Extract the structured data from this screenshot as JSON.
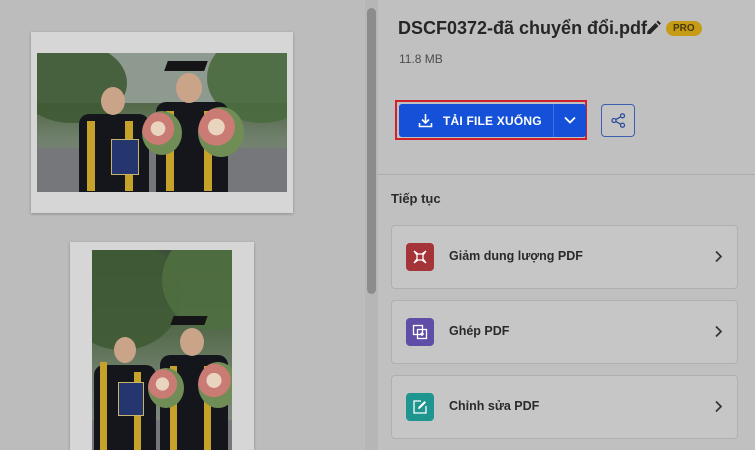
{
  "file": {
    "name": "DSCF0372-đã chuyển đổi.pdf",
    "size": "11.8 MB",
    "badge": "PRO"
  },
  "actions": {
    "download_label": "TẢI FILE XUỐNG"
  },
  "continue": {
    "title": "Tiếp tục",
    "tools": [
      {
        "label": "Giảm dung lượng PDF",
        "color": "#a53439",
        "icon": "compress-icon"
      },
      {
        "label": "Ghép PDF",
        "color": "#5f4da8",
        "icon": "merge-icon"
      },
      {
        "label": "Chỉnh sửa PDF",
        "color": "#1e958f",
        "icon": "edit-pdf-icon"
      }
    ]
  },
  "colors": {
    "accent": "#1450d8",
    "highlight": "#d0202b",
    "pro": "#c69b16"
  }
}
